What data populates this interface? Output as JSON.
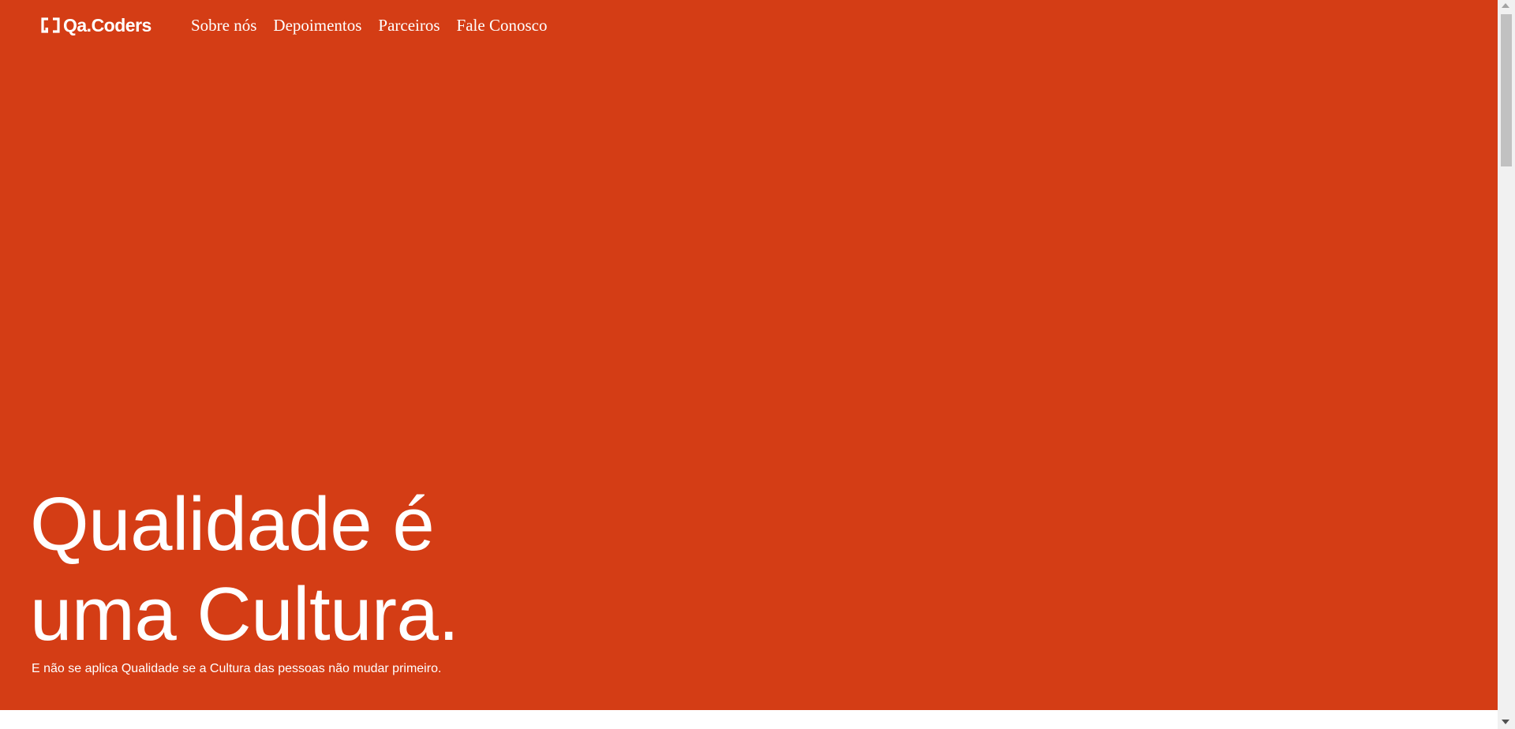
{
  "brand": {
    "logo_text": "Qa.Coders",
    "logo_icon": "brackets-logo-icon"
  },
  "nav": {
    "items": [
      {
        "label": "Sobre nós"
      },
      {
        "label": "Depoimentos"
      },
      {
        "label": "Parceiros"
      },
      {
        "label": "Fale Conosco"
      }
    ]
  },
  "hero": {
    "headline_line1": "Qualidade é",
    "headline_line2": "uma Cultura.",
    "subtext": "E não se aplica Qualidade se a Cultura das pessoas não mudar primeiro."
  },
  "colors": {
    "hero_background": "#d43d15",
    "text": "#ffffff",
    "page_background": "#ffffff"
  }
}
